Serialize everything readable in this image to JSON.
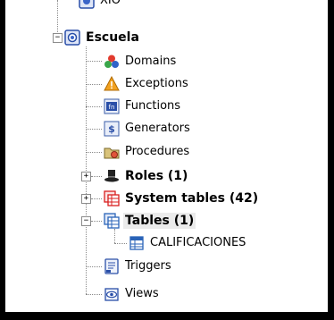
{
  "tree": {
    "partial_top_label": "XIO",
    "database": {
      "label": "Escuela",
      "expander": "−",
      "icon": "database-icon"
    },
    "children": [
      {
        "label": "Domains",
        "icon": "domains-icon",
        "bold": false
      },
      {
        "label": "Exceptions",
        "icon": "warning-icon",
        "bold": false
      },
      {
        "label": "Functions",
        "icon": "function-icon",
        "bold": false
      },
      {
        "label": "Generators",
        "icon": "generator-icon",
        "bold": false
      },
      {
        "label": "Procedures",
        "icon": "procedure-icon",
        "bold": false
      },
      {
        "label": "Roles (1)",
        "icon": "top-hat-icon",
        "bold": true,
        "expander": "+"
      },
      {
        "label": "System tables (42)",
        "icon": "system-tables-icon",
        "bold": true,
        "expander": "+"
      },
      {
        "label": "Tables (1)",
        "icon": "tables-icon",
        "bold": true,
        "expander": "−",
        "selected": true
      },
      {
        "label": "CALIFICACIONES",
        "icon": "table-icon",
        "bold": false
      },
      {
        "label": "Triggers",
        "icon": "trigger-icon",
        "bold": false
      },
      {
        "label": "Views",
        "icon": "view-icon",
        "bold": false
      }
    ]
  },
  "colors": {
    "frame": "#000000",
    "panel": "#ffffff",
    "tree_lines": "#8a8a8a",
    "selection": "#ebebeb",
    "system_tables_red": "#d81e1e",
    "table_blue": "#2a63b8"
  }
}
